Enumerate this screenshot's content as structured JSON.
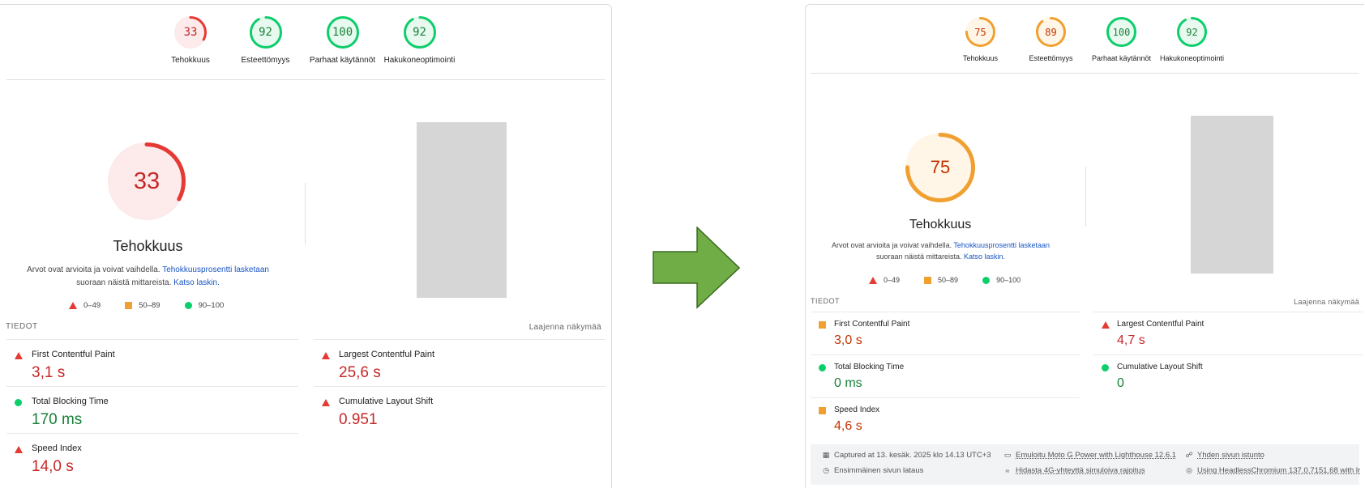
{
  "colors": {
    "fail": "#e53935",
    "fail_text": "#c62828",
    "average": "#f0a030",
    "average_text": "#c33300",
    "pass": "#0cce6b",
    "pass_text": "#178239",
    "arrow": "#70ad47"
  },
  "before": {
    "gauges": [
      {
        "score": "33",
        "label": "Tehokkuus",
        "status": "fail",
        "fraction": 0.33
      },
      {
        "score": "92",
        "label": "Esteettömyys",
        "status": "pass",
        "fraction": 0.92
      },
      {
        "score": "100",
        "label": "Parhaat käytännöt",
        "status": "pass",
        "fraction": 1.0
      },
      {
        "score": "92",
        "label": "Hakukoneoptimointi",
        "status": "pass",
        "fraction": 0.92
      }
    ],
    "main_score": "33",
    "main_fraction": 0.33,
    "category_title": "Tehokkuus",
    "desc_prefix": "Arvot ovat arvioita ja voivat vaihdella. ",
    "desc_link1": "Tehokkuusprosentti lasketaan",
    "desc_middle": "suoraan näistä mittareista. ",
    "desc_link2": "Katso laskin.",
    "legend": [
      "0–49",
      "50–89",
      "90–100"
    ],
    "tiedot": "TIEDOT",
    "expand": "Laajenna näkymää",
    "metrics": [
      {
        "label": "First Contentful Paint",
        "value": "3,1 s",
        "status": "fail"
      },
      {
        "label": "Largest Contentful Paint",
        "value": "25,6 s",
        "status": "fail"
      },
      {
        "label": "Total Blocking Time",
        "value": "170 ms",
        "status": "pass"
      },
      {
        "label": "Cumulative Layout Shift",
        "value": "0.951",
        "status": "fail"
      },
      {
        "label": "Speed Index",
        "value": "14,0 s",
        "status": "fail"
      }
    ]
  },
  "after": {
    "gauges": [
      {
        "score": "75",
        "label": "Tehokkuus",
        "status": "average",
        "fraction": 0.75
      },
      {
        "score": "89",
        "label": "Esteettömyys",
        "status": "average",
        "fraction": 0.89
      },
      {
        "score": "100",
        "label": "Parhaat käytännöt",
        "status": "pass",
        "fraction": 1.0
      },
      {
        "score": "92",
        "label": "Hakukoneoptimointi",
        "status": "pass",
        "fraction": 0.92
      }
    ],
    "main_score": "75",
    "main_fraction": 0.75,
    "category_title": "Tehokkuus",
    "desc_prefix": "Arvot ovat arvioita ja voivat vaihdella. ",
    "desc_link1": "Tehokkuusprosentti lasketaan",
    "desc_middle": "suoraan näistä mittareista. ",
    "desc_link2": "Katso laskin.",
    "legend": [
      "0–49",
      "50–89",
      "90–100"
    ],
    "tiedot": "TIEDOT",
    "expand": "Laajenna näkymää",
    "metrics": [
      {
        "label": "First Contentful Paint",
        "value": "3,0 s",
        "status": "average"
      },
      {
        "label": "Largest Contentful Paint",
        "value": "4,7 s",
        "status": "fail"
      },
      {
        "label": "Total Blocking Time",
        "value": "0 ms",
        "status": "pass"
      },
      {
        "label": "Cumulative Layout Shift",
        "value": "0",
        "status": "pass"
      },
      {
        "label": "Speed Index",
        "value": "4,6 s",
        "status": "average"
      }
    ],
    "footer": [
      {
        "icon": "calendar-icon",
        "text": "Captured at 13. kesäk. 2025 klo 14.13 UTC+3"
      },
      {
        "icon": "device-icon",
        "text": "Emuloitu Moto G Power with Lighthouse 12.6.1"
      },
      {
        "icon": "person-icon",
        "text": "Yhden sivun istunto"
      },
      {
        "icon": "timer-icon",
        "text": "Ensimmäinen sivun lataus"
      },
      {
        "icon": "wifi-icon",
        "text": "Hidasta 4G-yhteyttä simuloiva rajoitus"
      },
      {
        "icon": "browser-icon",
        "text": "Using HeadlessChromium 137.0.7151.68 with lr"
      }
    ]
  }
}
